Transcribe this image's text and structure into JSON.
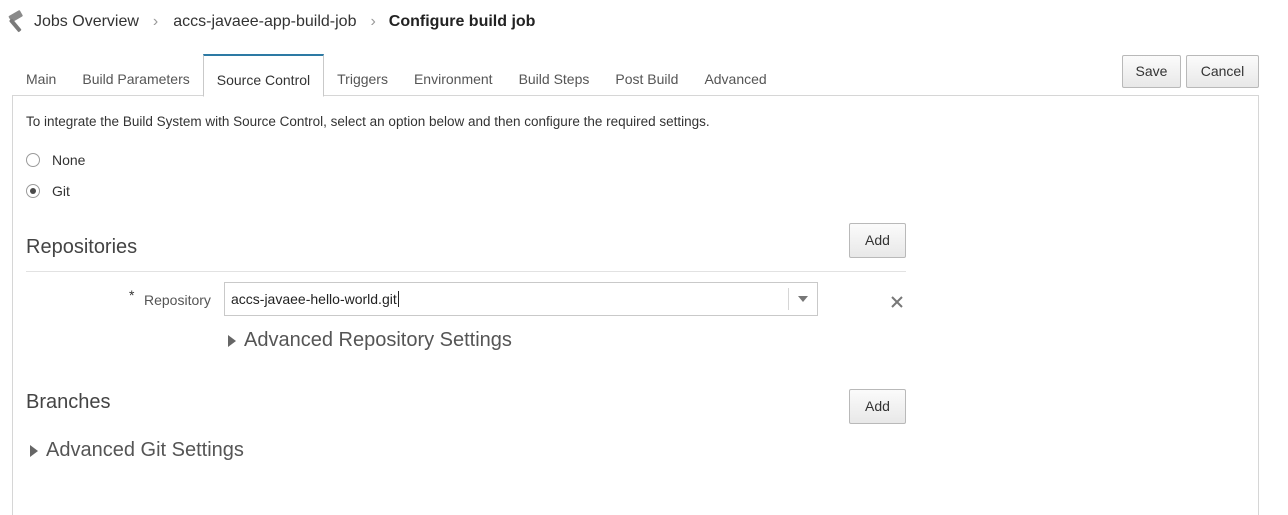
{
  "breadcrumb": {
    "icon": "hammer-icon",
    "items": [
      "Jobs Overview",
      "accs-javaee-app-build-job"
    ],
    "current": "Configure build job"
  },
  "tabs": [
    {
      "label": "Main",
      "active": false
    },
    {
      "label": "Build Parameters",
      "active": false
    },
    {
      "label": "Source Control",
      "active": true
    },
    {
      "label": "Triggers",
      "active": false
    },
    {
      "label": "Environment",
      "active": false
    },
    {
      "label": "Build Steps",
      "active": false
    },
    {
      "label": "Post Build",
      "active": false
    },
    {
      "label": "Advanced",
      "active": false
    }
  ],
  "toolbar": {
    "save_label": "Save",
    "cancel_label": "Cancel"
  },
  "source_control": {
    "intro": "To integrate the Build System with Source Control, select an option below and then configure the required settings.",
    "options": [
      {
        "label": "None",
        "checked": false
      },
      {
        "label": "Git",
        "checked": true
      }
    ]
  },
  "repositories": {
    "title": "Repositories",
    "add_label": "Add",
    "required_mark": "*",
    "field_label": "Repository",
    "value": "accs-javaee-hello-world.git",
    "advanced_label": "Advanced Repository Settings"
  },
  "branches": {
    "title": "Branches",
    "add_label": "Add"
  },
  "advanced_git_label": "Advanced Git Settings",
  "colors": {
    "accent": "#2d7aa4",
    "panel_border": "#d6d6d6"
  }
}
